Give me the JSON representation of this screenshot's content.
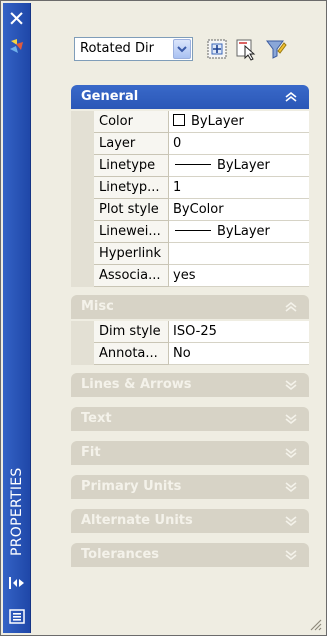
{
  "palette": {
    "title": "PROPERTIES",
    "icons": {
      "close": "close-icon",
      "auto_hide": "auto-hide-icon",
      "properties": "properties-toggle-icon",
      "menu": "menu-icon"
    }
  },
  "toolbar": {
    "object_type": "Rotated Dir",
    "buttons": [
      "toggle-pickadd-icon",
      "select-objects-icon",
      "quick-select-icon"
    ]
  },
  "sections": {
    "general": {
      "label": "General",
      "expanded": true,
      "rows": [
        {
          "name": "Color",
          "value": "ByLayer"
        },
        {
          "name": "Layer",
          "value": "0"
        },
        {
          "name": "Linetype",
          "value": "ByLayer"
        },
        {
          "name": "Linetyp...",
          "value": "1"
        },
        {
          "name": "Plot style",
          "value": "ByColor"
        },
        {
          "name": "Linewei...",
          "value": "ByLayer"
        },
        {
          "name": "Hyperlink",
          "value": ""
        },
        {
          "name": "Associa...",
          "value": "yes"
        }
      ]
    },
    "misc": {
      "label": "Misc",
      "expanded": true,
      "rows": [
        {
          "name": "Dim style",
          "value": "ISO-25"
        },
        {
          "name": "Annota...",
          "value": "No"
        }
      ]
    },
    "lines_arrows": {
      "label": "Lines & Arrows"
    },
    "text": {
      "label": "Text"
    },
    "fit": {
      "label": "Fit"
    },
    "primary_units": {
      "label": "Primary Units"
    },
    "alternate_units": {
      "label": "Alternate Units"
    },
    "tolerances": {
      "label": "Tolerances"
    }
  },
  "colors": {
    "title_strip": "#2a55b8",
    "active_header": "#3264c4",
    "muted_header": "#d7d3c6"
  }
}
